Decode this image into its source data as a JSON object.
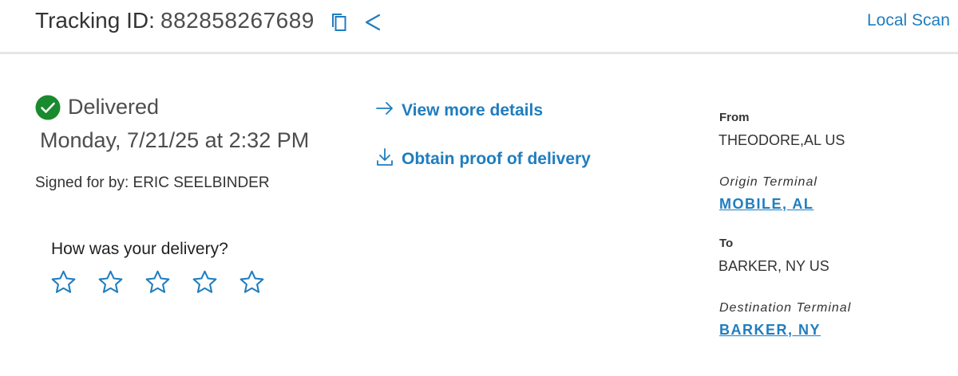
{
  "header": {
    "tracking_label": "Tracking ID:",
    "tracking_number": "882858267689",
    "copy_icon": "copy-icon",
    "share_icon": "share-icon",
    "local_scan_label": "Local Scan"
  },
  "status": {
    "label": "Delivered",
    "date": "Monday, 7/21/25 at 2:32 PM",
    "signed_for": "Signed for by: ERIC SEELBINDER",
    "icon": "check-circle-icon",
    "icon_color": "#1a8a2e"
  },
  "feedback": {
    "question": "How was your delivery?",
    "rating_max": 5,
    "rating_value": 0,
    "star_icon": "star-outline-icon"
  },
  "actions": {
    "view_details": {
      "label": "View more details",
      "icon": "arrow-right-icon"
    },
    "proof_of_delivery": {
      "label": "Obtain proof of delivery",
      "icon": "download-icon"
    }
  },
  "route": {
    "from_label": "From",
    "from_value": "THEODORE,AL US",
    "origin_terminal_label": "Origin Terminal",
    "origin_terminal_value": "MOBILE, AL",
    "to_label": "To",
    "to_value": "BARKER, NY US",
    "destination_terminal_label": "Destination Terminal",
    "destination_terminal_value": "BARKER, NY"
  },
  "colors": {
    "link_blue": "#1f7dbf",
    "success_green": "#1a8a2e",
    "text_dark": "#333333",
    "header_border": "#e6e6e6"
  }
}
